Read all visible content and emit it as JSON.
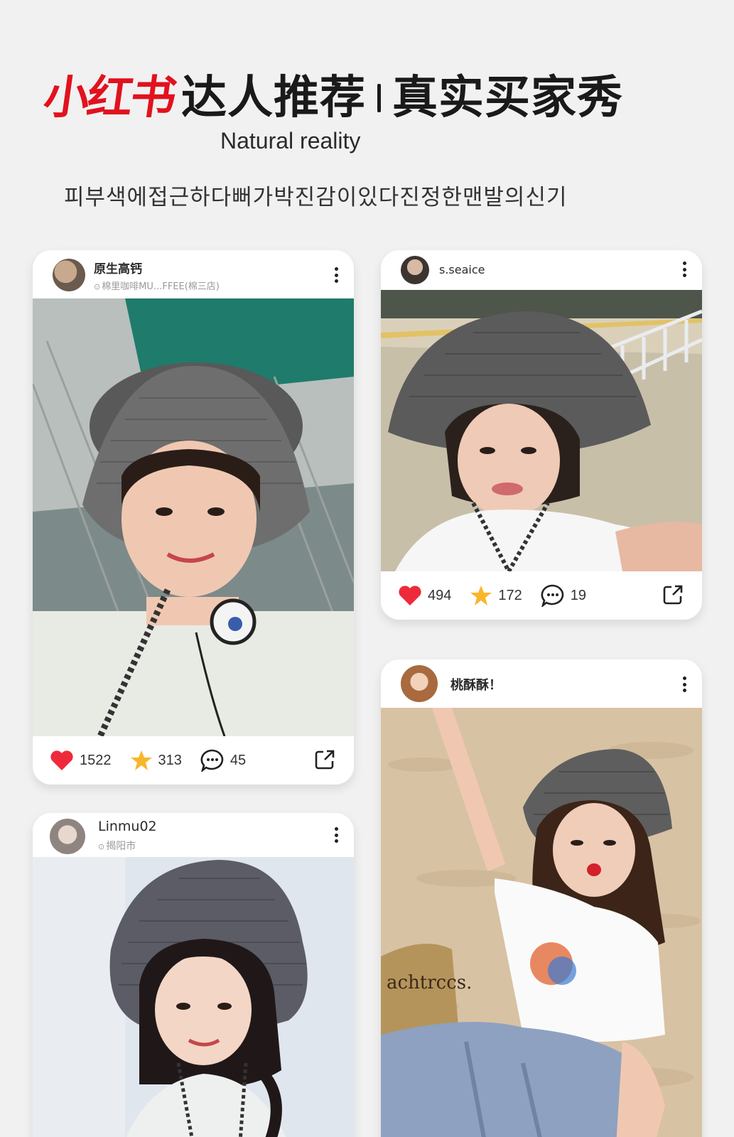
{
  "header": {
    "brand": "小红书",
    "title": "达人推荐",
    "title_right": "真实买家秀",
    "subtitle": "Natural reality",
    "korean_line": "피부색에접근하다뻐가박진감이있다진정한맨발의신기"
  },
  "colors": {
    "brand_red": "#e1121e",
    "like_red": "#ee2a3a",
    "star_yellow": "#f8b62b"
  },
  "cards": [
    {
      "user": "原生高钙",
      "location": "棉里咖啡MU...FFEE(棉三店)",
      "likes": "1522",
      "stars": "313",
      "comments": "45"
    },
    {
      "user": "s.seaice",
      "likes": "494",
      "stars": "172",
      "comments": "19"
    },
    {
      "user": "桃酥酥！"
    },
    {
      "user": "Linmu02",
      "location": "揭阳市"
    }
  ]
}
